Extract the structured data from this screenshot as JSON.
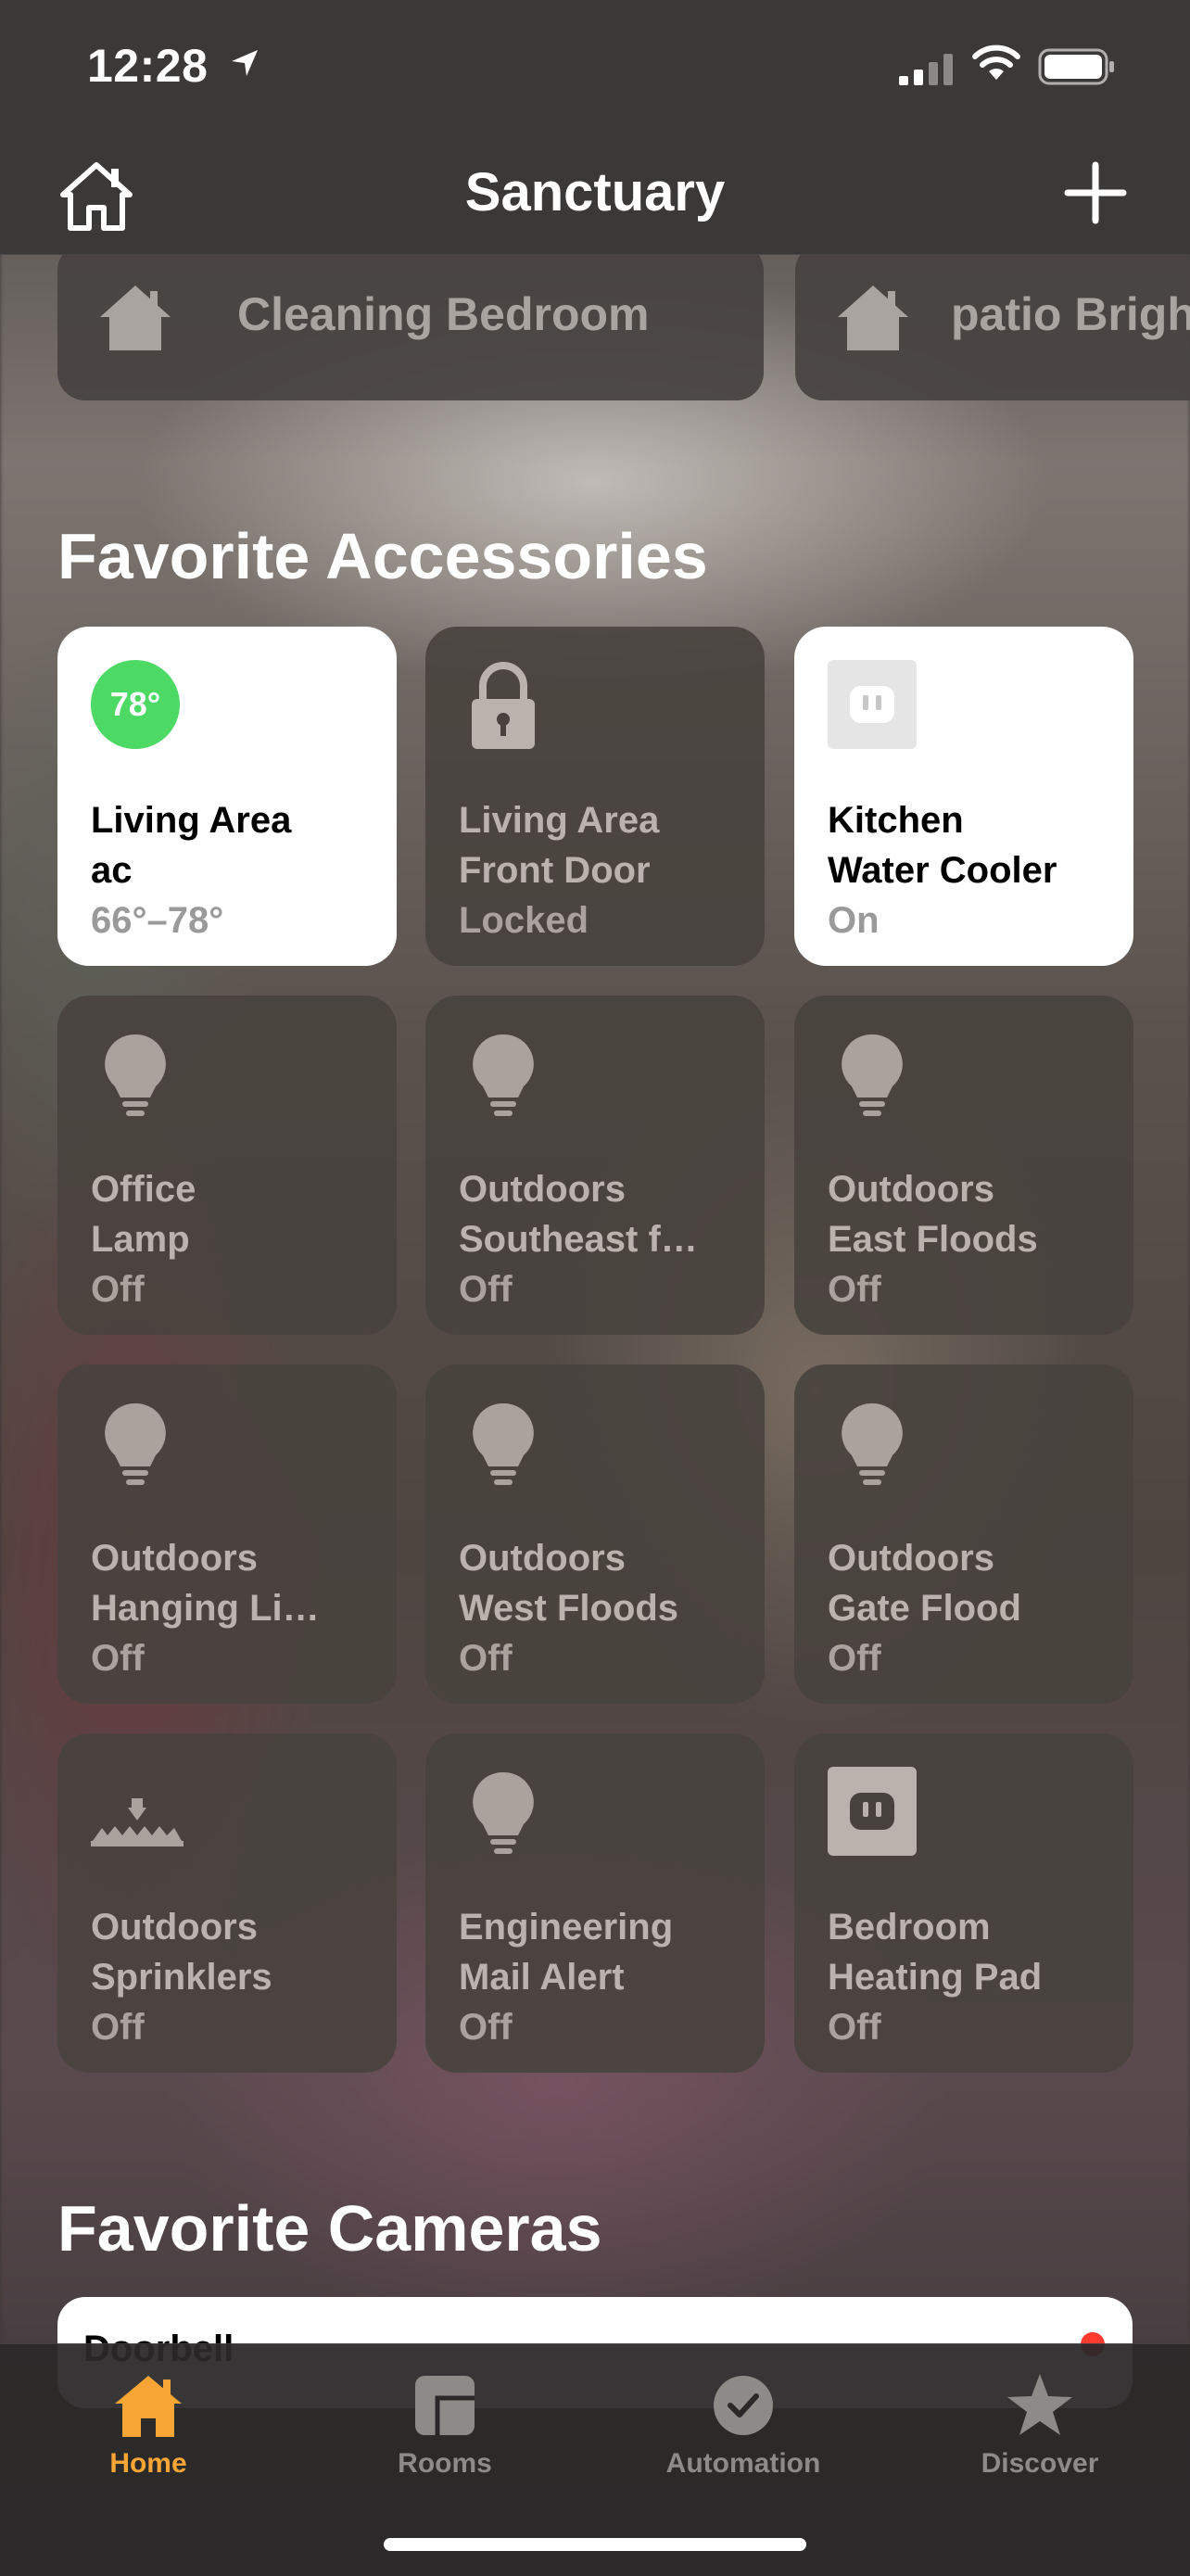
{
  "status_bar": {
    "time": "12:28",
    "icons": [
      "location-arrow-icon",
      "cellular-signal-icon",
      "wifi-icon",
      "battery-icon"
    ]
  },
  "nav": {
    "title": "Sanctuary",
    "left_icon": "home-icon",
    "right_icon": "add-icon"
  },
  "scenes": [
    {
      "label": "Cleaning Bedroom",
      "icon": "house-icon"
    },
    {
      "label": "patio Brigh",
      "icon": "house-icon"
    }
  ],
  "favorite_accessories": {
    "title": "Favorite Accessories",
    "tiles": [
      {
        "line1": "Living Area",
        "line2": "ac",
        "status": "66°–78°",
        "badge": "78°",
        "state": "on",
        "icon": "thermostat-icon"
      },
      {
        "line1": "Living Area",
        "line2": "Front Door",
        "status": "Locked",
        "state": "off",
        "icon": "lock-icon"
      },
      {
        "line1": "Kitchen",
        "line2": "Water Cooler",
        "status": "On",
        "state": "on",
        "icon": "outlet-icon"
      },
      {
        "line1": "Office",
        "line2": "Lamp",
        "status": "Off",
        "state": "off",
        "icon": "lightbulb-icon"
      },
      {
        "line1": "Outdoors",
        "line2": "Southeast f…",
        "status": "Off",
        "state": "off",
        "icon": "lightbulb-icon"
      },
      {
        "line1": "Outdoors",
        "line2": "East Floods",
        "status": "Off",
        "state": "off",
        "icon": "lightbulb-icon"
      },
      {
        "line1": "Outdoors",
        "line2": "Hanging Li…",
        "status": "Off",
        "state": "off",
        "icon": "lightbulb-icon"
      },
      {
        "line1": "Outdoors",
        "line2": "West Floods",
        "status": "Off",
        "state": "off",
        "icon": "lightbulb-icon"
      },
      {
        "line1": "Outdoors",
        "line2": "Gate Flood",
        "status": "Off",
        "state": "off",
        "icon": "lightbulb-icon"
      },
      {
        "line1": "Outdoors",
        "line2": "Sprinklers",
        "status": "Off",
        "state": "off",
        "icon": "sprinkler-icon"
      },
      {
        "line1": "Engineering",
        "line2": "Mail Alert",
        "status": "Off",
        "state": "off",
        "icon": "lightbulb-icon"
      },
      {
        "line1": "Bedroom",
        "line2": "Heating Pad",
        "status": "Off",
        "state": "off",
        "icon": "outlet-icon"
      }
    ]
  },
  "favorite_cameras": {
    "title": "Favorite Cameras",
    "cameras": [
      {
        "label": "Doorbell"
      }
    ]
  },
  "tabbar": {
    "tabs": [
      {
        "label": "Home",
        "icon": "house-icon",
        "active": true
      },
      {
        "label": "Rooms",
        "icon": "rooms-icon",
        "active": false
      },
      {
        "label": "Automation",
        "icon": "automation-icon",
        "active": false
      },
      {
        "label": "Discover",
        "icon": "star-icon",
        "active": false
      }
    ],
    "accent": "#f7a535"
  },
  "colors": {
    "thermostat_badge": "#4cd964",
    "tile_on": "#ffffff",
    "tile_off": "#48423e",
    "recording_dot": "#ff3b30"
  }
}
